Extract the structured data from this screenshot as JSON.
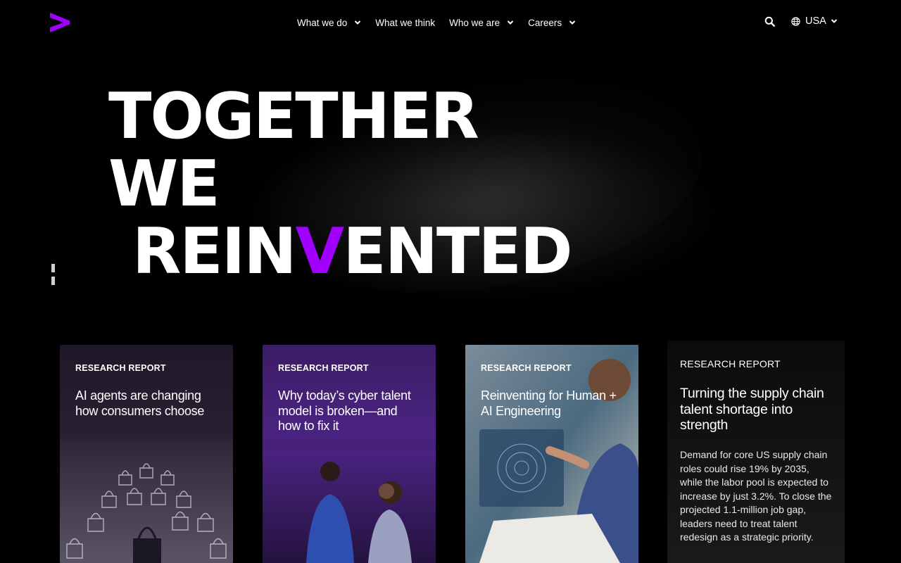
{
  "header": {
    "nav": [
      {
        "label": "What we do",
        "has_dropdown": true
      },
      {
        "label": "What we think",
        "has_dropdown": false
      },
      {
        "label": "Who we are",
        "has_dropdown": true
      },
      {
        "label": "Careers",
        "has_dropdown": true
      }
    ],
    "country_label": "USA",
    "icons": {
      "logo": "accenture-logo-icon",
      "search": "search-icon",
      "globe": "globe-icon",
      "chevron": "chevron-down-icon"
    }
  },
  "hero": {
    "line1": "TOGETHER WE",
    "line2_start": "REIN",
    "line2_accent": "V",
    "line2_end": "ENTED",
    "pause_icon": "pause-icon"
  },
  "cards": [
    {
      "tag": "RESEARCH REPORT",
      "title": "AI agents are changing how consumers choose"
    },
    {
      "tag": "RESEARCH REPORT",
      "title": "Why today’s cyber talent model is broken—and how to fix it"
    },
    {
      "tag": "RESEARCH REPORT",
      "title": "Reinventing for Human + AI Engineering"
    },
    {
      "tag": "RESEARCH REPORT",
      "title": "Turning the supply chain talent shortage into strength",
      "description": "Demand for core US supply chain roles could rise 19% by 2035, while the labor pool is expected to increase by just 3.2%. To close the projected 1.1-million job gap, leaders need to treat talent redesign as a strategic priority."
    }
  ],
  "colors": {
    "accent": "#a100ff",
    "background": "#000000",
    "text": "#ffffff"
  }
}
